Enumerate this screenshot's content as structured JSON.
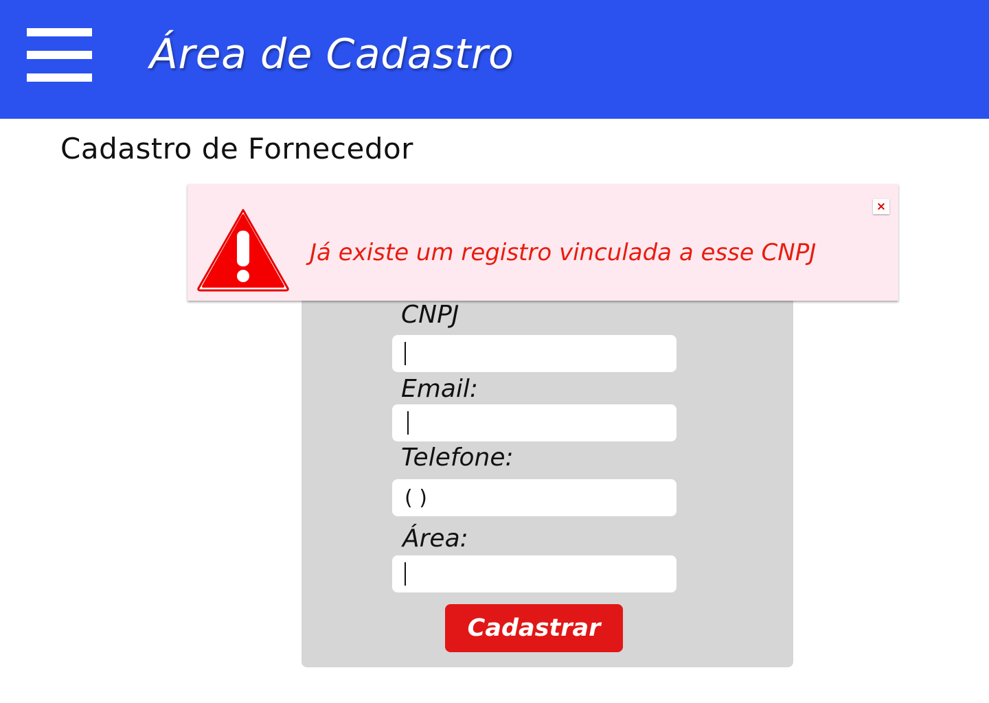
{
  "header": {
    "title": "Área de Cadastro",
    "menu_icon": "hamburger-menu-icon",
    "background_color": "#2b52ee"
  },
  "page": {
    "title": "Cadastro de Fornecedor"
  },
  "alert": {
    "message": "Já existe um registro vinculada a esse CNPJ",
    "close_symbol": "×",
    "icon": "warning-triangle-icon",
    "text_color": "#e81c0f",
    "background_color": "#fde9ef"
  },
  "form": {
    "background_color": "#d6d6d6",
    "fields": [
      {
        "label": "CNPJ",
        "value": ""
      },
      {
        "label": "Email:",
        "value": ""
      },
      {
        "label": "Telefone:",
        "value": "( )"
      },
      {
        "label": "Área:",
        "value": ""
      }
    ],
    "submit_label": "Cadastrar",
    "submit_color": "#e11717"
  }
}
